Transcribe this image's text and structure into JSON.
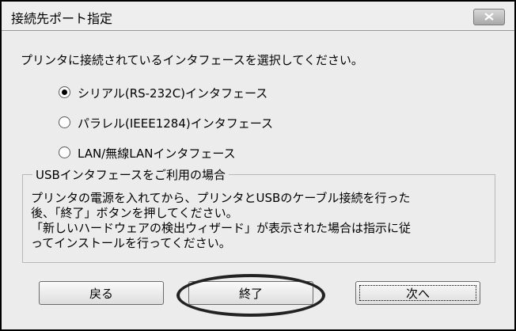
{
  "window": {
    "title": "接続先ポート指定",
    "close_icon": "close-icon"
  },
  "prompt": "プリンタに接続されているインタフェースを選択してください。",
  "options": [
    {
      "label": "シリアル(RS-232C)インタフェース",
      "checked": true
    },
    {
      "label": "パラレル(IEEE1284)インタフェース",
      "checked": false
    },
    {
      "label": "LAN/無線LANインタフェース",
      "checked": false
    }
  ],
  "usb_group": {
    "title": "USBインタフェースをご利用の場合",
    "lines": [
      "プリンタの電源を入れてから、プリンタとUSBのケーブル接続を行った",
      "後、「終了」ボタンを押してください。",
      "「新しいハードウェアの検出ウィザード」が表示された場合は指示に従",
      "ってインストールを行ってください。"
    ]
  },
  "buttons": {
    "back": "戻る",
    "finish": "終了",
    "next": "次へ"
  },
  "colors": {
    "dialog_bg": "#ececec",
    "highlight_oval": "#222222"
  }
}
